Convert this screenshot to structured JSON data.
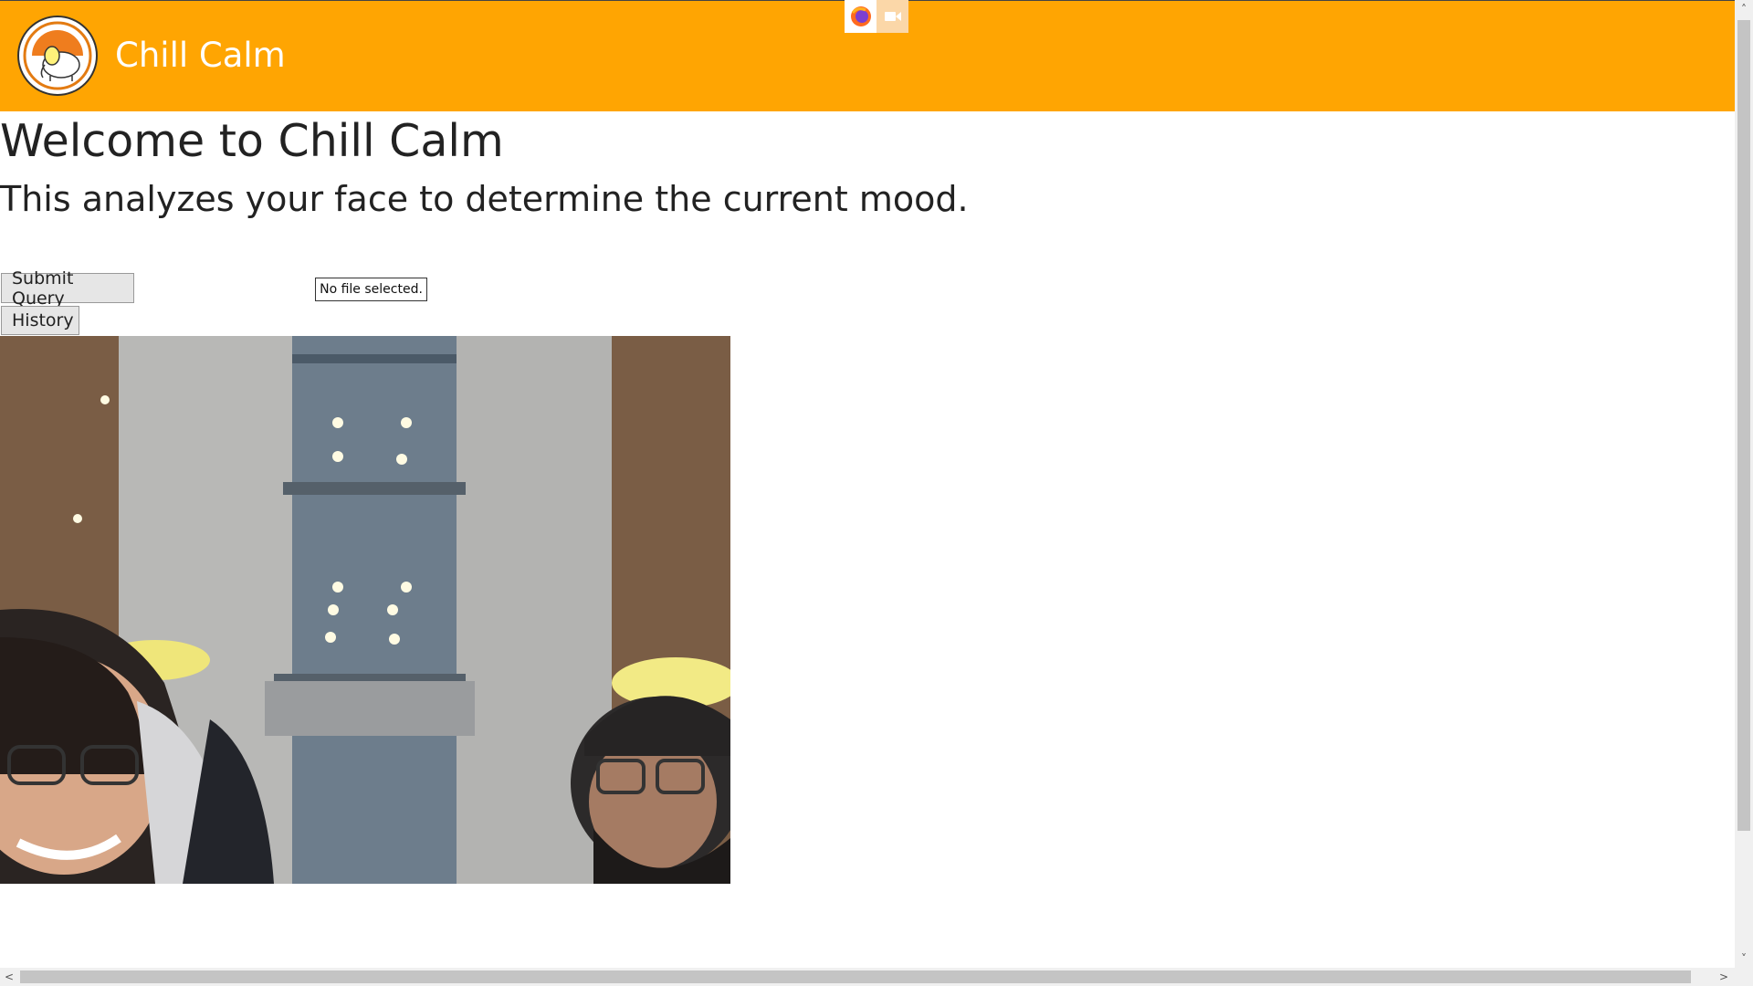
{
  "header": {
    "title": "Chill Calm",
    "background_color": "#ffa502",
    "logo_icon": "elephant-logo-icon"
  },
  "sharing_indicator": {
    "icons": [
      "firefox-icon",
      "camera-icon"
    ]
  },
  "main": {
    "heading": "Welcome to Chill Calm",
    "subtitle": "This analyzes your face to determine the current mood.",
    "submit_label": "Submit Query",
    "file_status": "No file selected.",
    "history_label": "History",
    "webcam_feed_icon": "webcam-video-icon"
  },
  "scrollbars": {
    "up_arrow": "˄",
    "down_arrow": "˅",
    "left_arrow": "<",
    "right_arrow": ">"
  }
}
